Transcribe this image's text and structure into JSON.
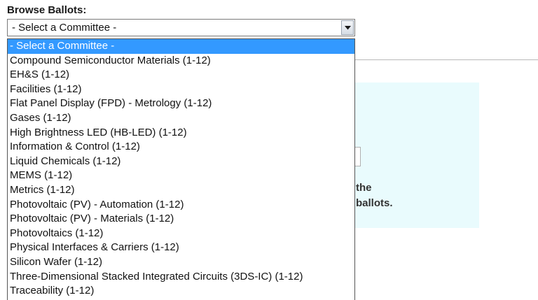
{
  "browse": {
    "label": "Browse Ballots:"
  },
  "committee_select": {
    "value": "- Select a Committee -",
    "expanded": true,
    "options": [
      {
        "label": "- Select a Committee -",
        "selected": true
      },
      {
        "label": "Compound Semiconductor Materials (1-12)",
        "selected": false
      },
      {
        "label": "EH&S (1-12)",
        "selected": false
      },
      {
        "label": "Facilities (1-12)",
        "selected": false
      },
      {
        "label": "Flat Panel Display (FPD) - Metrology (1-12)",
        "selected": false
      },
      {
        "label": "Gases (1-12)",
        "selected": false
      },
      {
        "label": "High Brightness LED (HB-LED) (1-12)",
        "selected": false
      },
      {
        "label": "Information & Control (1-12)",
        "selected": false
      },
      {
        "label": "Liquid Chemicals (1-12)",
        "selected": false
      },
      {
        "label": "MEMS (1-12)",
        "selected": false
      },
      {
        "label": "Metrics (1-12)",
        "selected": false
      },
      {
        "label": "Photovoltaic (PV) - Automation (1-12)",
        "selected": false
      },
      {
        "label": "Photovoltaic (PV) - Materials (1-12)",
        "selected": false
      },
      {
        "label": "Photovoltaics (1-12)",
        "selected": false
      },
      {
        "label": "Physical Interfaces & Carriers (1-12)",
        "selected": false
      },
      {
        "label": "Silicon Wafer (1-12)",
        "selected": false
      },
      {
        "label": "Three-Dimensional Stacked Integrated Circuits (3DS-IC) (1-12)",
        "selected": false
      },
      {
        "label": "Traceability (1-12)",
        "selected": false
      }
    ]
  },
  "background_panel": {
    "line1": "the",
    "line2": "ballots."
  },
  "colors": {
    "selected_option_bg": "#3399ff",
    "panel_bg": "#e9fbfd"
  },
  "icons": {
    "select_arrow": "chevron-down-icon"
  }
}
